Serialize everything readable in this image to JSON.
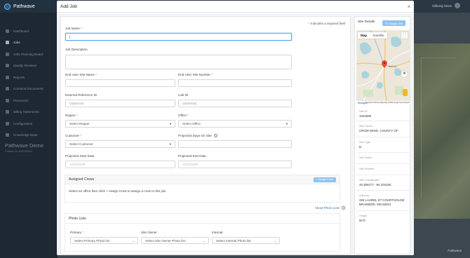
{
  "app": {
    "name": "Pathwave",
    "demo_title": "Pathwave Demo",
    "demo_sub": "Forked on 11/22/2022"
  },
  "nav": [
    "Dashboard",
    "Jobs",
    "Jobs Planning Board",
    "Quality Reviews",
    "Reports",
    "Contacts Documents",
    "Personnel",
    "Billing Statements",
    "Configuration",
    "Knowledge Base"
  ],
  "user": {
    "name": "Gillivray Moss"
  },
  "footer_brand": "Pathwave",
  "modal": {
    "title": "Add Job",
    "close": "×",
    "required_note": "Indicates a required field",
    "job_name": {
      "label": "Job Name",
      "value": "|"
    },
    "job_description": {
      "label": "Job Description"
    },
    "end_user_site_name": {
      "label": "End User Site Name"
    },
    "end_user_site_number": {
      "label": "End User Site Number"
    },
    "external_reference_id": {
      "label": "External Reference ID",
      "placeholder": "(Optional)"
    },
    "link_id": {
      "label": "Link ID",
      "placeholder": "(Optional)"
    },
    "region": {
      "label": "Region",
      "value": "Select Region"
    },
    "office": {
      "label": "Office",
      "value": "Select Office"
    },
    "customer": {
      "label": "Customer",
      "value": "Select Customer"
    },
    "projected_days_on_site": {
      "label": "Projected Days On Site"
    },
    "projected_start_date": {
      "label": "Projected Start Date",
      "placeholder": "11/23/2025"
    },
    "projected_end_date": {
      "label": "Projected End Date",
      "placeholder": "11/23/2025"
    },
    "assigned_crews": {
      "title": "Assigned Crews",
      "button": "+ Assign Crew",
      "message": "Select an office then click + Assign Crew to assign a crew to this job."
    },
    "about_photo_lists": "About Photo Lists",
    "photo_lists": {
      "title": "Photo Lists",
      "primary": {
        "label": "Primary",
        "value": "Select Primary Photo list"
      },
      "site_owner": {
        "label": "Site Owner",
        "value": "Select Site Owner Photo list"
      },
      "internal": {
        "label": "Internal",
        "value": "Select Internal Photo list"
      }
    }
  },
  "site": {
    "title": "Site Details",
    "change_button": "✎ Change Site",
    "map": {
      "map_tab": "Map",
      "satellite_tab": "Satellite",
      "attribution": "Keyboard shortcuts   Map data ©2025 Google   Terms   Report a map error",
      "google": "Google",
      "town": "Brainerd"
    },
    "fields": [
      {
        "label": "Site ID",
        "value": "1022696"
      },
      {
        "label": "Site Owner",
        "value": "CROW WING, COUNTY OF"
      },
      {
        "label": "Site Type",
        "value": "B"
      },
      {
        "label": "Site Name",
        "value": ""
      },
      {
        "label": "Site Number",
        "value": ""
      },
      {
        "label": "Site Coordinates",
        "value": "46.355277, -94.204166"
      },
      {
        "label": "Address",
        "value": "326 LAUREL ST COURTHOUSE BRAINERD, MN 56401"
      },
      {
        "label": "Height",
        "value": "60 ft"
      }
    ]
  }
}
